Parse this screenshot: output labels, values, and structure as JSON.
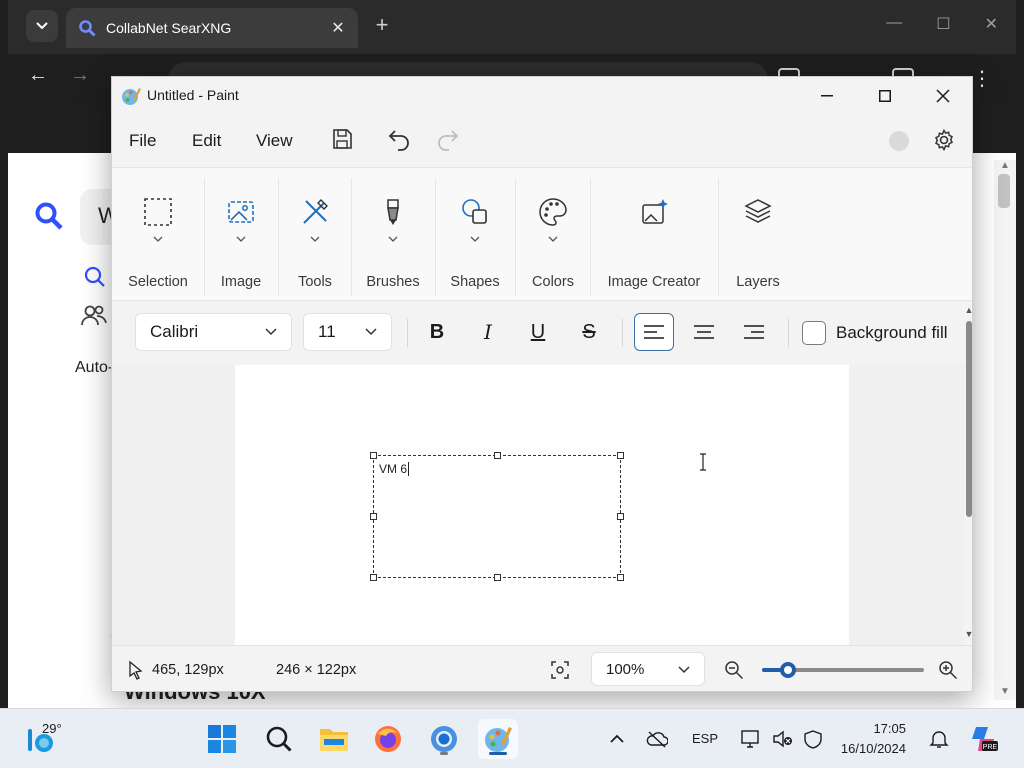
{
  "browser": {
    "tab_title": "CollabNet SearXNG",
    "omnibox_hint": "",
    "page": {
      "search_prefix": "W",
      "auto_text": "Auto-",
      "bottom_heading": "Windows 10X"
    }
  },
  "paint": {
    "title": "Untitled - Paint",
    "menu": [
      "File",
      "Edit",
      "View"
    ],
    "ribbon": [
      {
        "label": "Selection",
        "icon": "selection-icon"
      },
      {
        "label": "Image",
        "icon": "image-icon"
      },
      {
        "label": "Tools",
        "icon": "tools-icon"
      },
      {
        "label": "Brushes",
        "icon": "brush-icon"
      },
      {
        "label": "Shapes",
        "icon": "shapes-icon"
      },
      {
        "label": "Colors",
        "icon": "palette-icon"
      },
      {
        "label": "Image Creator",
        "icon": "image-creator-icon"
      },
      {
        "label": "Layers",
        "icon": "layers-icon"
      }
    ],
    "text_toolbar": {
      "font": "Calibri",
      "size": "11",
      "background_fill": "Background fill",
      "align_active": "left"
    },
    "textbox_content": "VM 6",
    "status": {
      "cursor_pos": "465, 129px",
      "selection_size": "246 × 122px",
      "zoom": "100%",
      "zoom_slider_fraction": 0.16
    },
    "accent": "#1f5ea8"
  },
  "taskbar": {
    "weather_temp": "29°",
    "language": "ESP",
    "time": "17:05",
    "date": "16/10/2024"
  }
}
